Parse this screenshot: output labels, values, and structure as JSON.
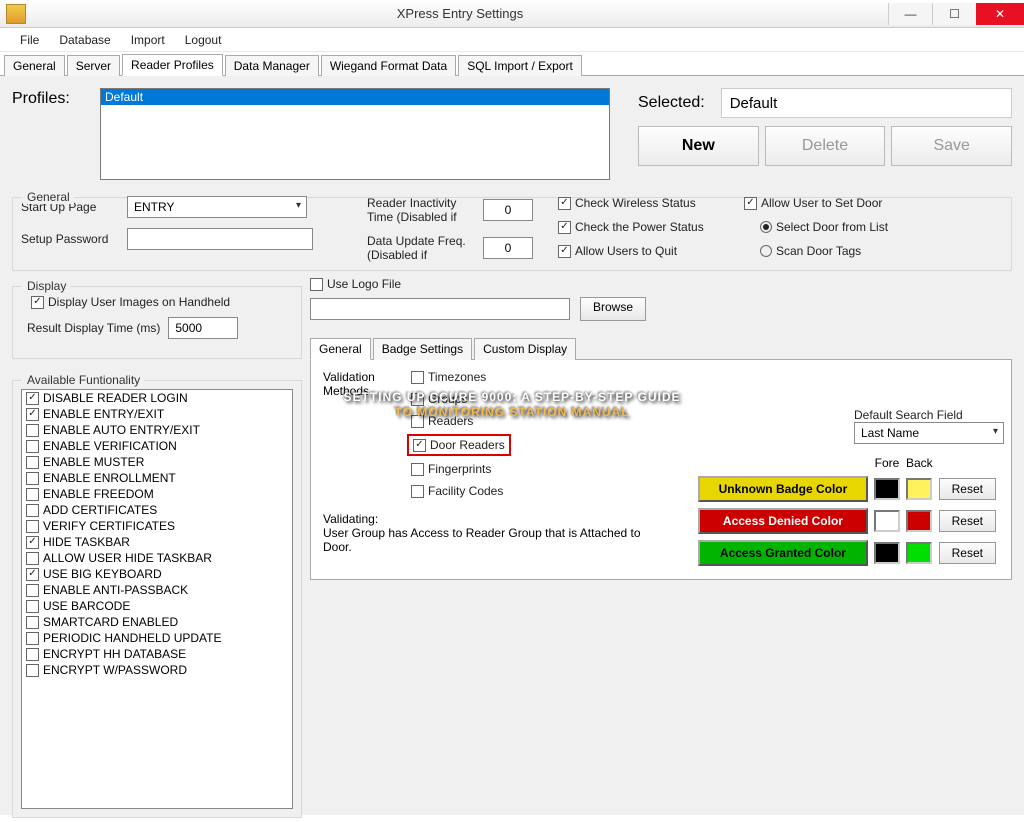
{
  "window": {
    "title": "XPress Entry Settings"
  },
  "menubar": [
    "File",
    "Database",
    "Import",
    "Logout"
  ],
  "tabs": [
    "General",
    "Server",
    "Reader Profiles",
    "Data Manager",
    "Wiegand Format Data",
    "SQL Import / Export"
  ],
  "active_tab": "Reader Profiles",
  "profiles": {
    "label": "Profiles:",
    "items": [
      "Default"
    ],
    "selected_label": "Selected:",
    "selected_value": "Default",
    "buttons": {
      "new": "New",
      "delete": "Delete",
      "save": "Save"
    }
  },
  "general": {
    "legend": "General",
    "startup_page_label": "Start Up Page",
    "startup_page_value": "ENTRY",
    "setup_password_label": "Setup Password",
    "setup_password_value": "",
    "reader_inactivity_label": "Reader Inactivity Time (Disabled if",
    "reader_inactivity_value": "0",
    "data_update_label": "Data Update Freq. (Disabled if",
    "data_update_value": "0",
    "check_wireless": "Check Wireless Status",
    "check_power": "Check the Power Status",
    "allow_quit": "Allow Users to Quit",
    "allow_set_door": "Allow User to Set Door",
    "select_door_from_list": "Select Door from List",
    "scan_door_tags": "Scan Door Tags"
  },
  "display": {
    "legend": "Display",
    "display_images": "Display User Images on Handheld",
    "result_time_label": "Result Display Time (ms)",
    "result_time_value": "5000",
    "use_logo_file": "Use Logo File",
    "browse": "Browse",
    "default_search_label": "Default Search Field",
    "default_search_value": "Last Name"
  },
  "functionality": {
    "legend": "Available Funtionality",
    "items": [
      {
        "label": "DISABLE READER LOGIN",
        "checked": true
      },
      {
        "label": "ENABLE ENTRY/EXIT",
        "checked": true
      },
      {
        "label": "ENABLE AUTO ENTRY/EXIT",
        "checked": false
      },
      {
        "label": "ENABLE VERIFICATION",
        "checked": false
      },
      {
        "label": "ENABLE MUSTER",
        "checked": false
      },
      {
        "label": "ENABLE ENROLLMENT",
        "checked": false
      },
      {
        "label": "ENABLE FREEDOM",
        "checked": false
      },
      {
        "label": "ADD CERTIFICATES",
        "checked": false
      },
      {
        "label": "VERIFY CERTIFICATES",
        "checked": false
      },
      {
        "label": "HIDE TASKBAR",
        "checked": true
      },
      {
        "label": "ALLOW USER HIDE TASKBAR",
        "checked": false
      },
      {
        "label": "USE BIG KEYBOARD",
        "checked": true
      },
      {
        "label": "ENABLE ANTI-PASSBACK",
        "checked": false
      },
      {
        "label": "USE BARCODE",
        "checked": false
      },
      {
        "label": "SMARTCARD ENABLED",
        "checked": false
      },
      {
        "label": "PERIODIC HANDHELD UPDATE",
        "checked": false
      },
      {
        "label": "ENCRYPT HH DATABASE",
        "checked": false
      },
      {
        "label": "ENCRYPT W/PASSWORD",
        "checked": false
      }
    ]
  },
  "subtabs": [
    "General",
    "Badge Settings",
    "Custom Display"
  ],
  "subpanel": {
    "methods_label": "Validation Methods",
    "methods": [
      {
        "label": "Timezones",
        "checked": false,
        "highlight": false
      },
      {
        "label": "Groups",
        "checked": false,
        "highlight": false
      },
      {
        "label": "Readers",
        "checked": false,
        "highlight": false
      },
      {
        "label": "Door Readers",
        "checked": true,
        "highlight": true
      },
      {
        "label": "Fingerprints",
        "checked": false,
        "highlight": false
      },
      {
        "label": "Facility Codes",
        "checked": false,
        "highlight": false
      }
    ],
    "validating_label": "Validating:",
    "validating_text": "User Group has Access to Reader Group that is Attached to Door.",
    "color_headers": {
      "fore": "Fore",
      "back": "Back"
    },
    "colors": [
      {
        "label": "Unknown Badge Color",
        "bg": "#e8d600",
        "fg": "#000000",
        "fore": "#000000",
        "back": "#fff25a"
      },
      {
        "label": "Access Denied Color",
        "bg": "#cc0000",
        "fg": "#ffffff",
        "fore": "#ffffff",
        "back": "#cc0000"
      },
      {
        "label": "Access Granted Color",
        "bg": "#00b400",
        "fg": "#000000",
        "fore": "#000000",
        "back": "#00e000"
      }
    ],
    "reset": "Reset"
  },
  "overlay": {
    "line1": "SETTING UP CCURE 9000: A STEP-BY-STEP GUIDE",
    "line2": "TO MONITORING STATION MANUAL"
  }
}
